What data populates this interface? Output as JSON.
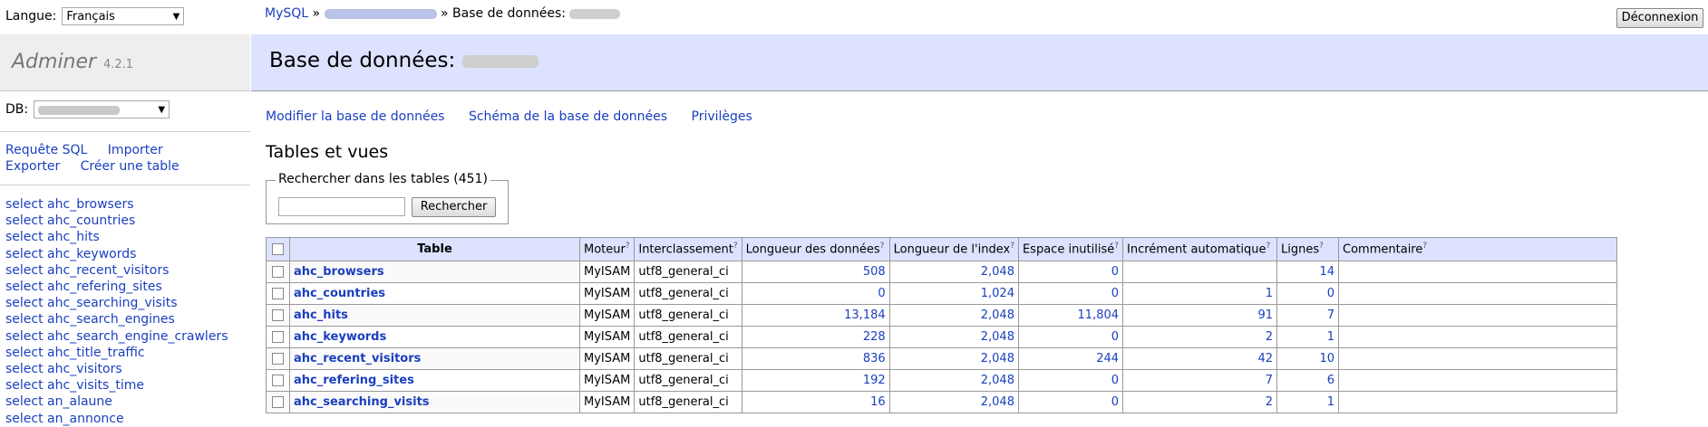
{
  "lang": {
    "label": "Langue:",
    "value": "Français"
  },
  "brand": {
    "name": "Adminer",
    "version": "4.2.1"
  },
  "db": {
    "label": "DB:"
  },
  "quick": {
    "sql": "Requête SQL",
    "import": "Importer",
    "export": "Exporter",
    "create": "Créer une table"
  },
  "sidebar_tables": [
    "select ahc_browsers",
    "select ahc_countries",
    "select ahc_hits",
    "select ahc_keywords",
    "select ahc_recent_visitors",
    "select ahc_refering_sites",
    "select ahc_searching_visits",
    "select ahc_search_engines",
    "select ahc_search_engine_crawlers",
    "select ahc_title_traffic",
    "select ahc_visitors",
    "select ahc_visits_time",
    "select an_alaune",
    "select an_annonce"
  ],
  "breadcrumb": {
    "root": "MySQL",
    "sep": "»",
    "db": "Base de données:"
  },
  "logout": "Déconnexion",
  "title": "Base de données:",
  "links": {
    "alter": "Modifier la base de données",
    "schema": "Schéma de la base de données",
    "privs": "Privilèges"
  },
  "tv_heading": "Tables et vues",
  "search": {
    "legend": "Rechercher dans les tables (451)",
    "button": "Rechercher",
    "value": ""
  },
  "table": {
    "headers": {
      "table": "Table",
      "engine": "Moteur",
      "collation": "Interclassement",
      "data_length": "Longueur des données",
      "index_length": "Longueur de l'index",
      "data_free": "Espace inutilisé",
      "auto_inc": "Incrément automatique",
      "rows": "Lignes",
      "comment": "Commentaire",
      "help": "?"
    },
    "rows": [
      {
        "name": "ahc_browsers",
        "engine": "MyISAM",
        "collation": "utf8_general_ci",
        "data": "508",
        "index": "2,048",
        "free": "0",
        "auto": "",
        "rows": "14"
      },
      {
        "name": "ahc_countries",
        "engine": "MyISAM",
        "collation": "utf8_general_ci",
        "data": "0",
        "index": "1,024",
        "free": "0",
        "auto": "1",
        "rows": "0"
      },
      {
        "name": "ahc_hits",
        "engine": "MyISAM",
        "collation": "utf8_general_ci",
        "data": "13,184",
        "index": "2,048",
        "free": "11,804",
        "auto": "91",
        "rows": "7"
      },
      {
        "name": "ahc_keywords",
        "engine": "MyISAM",
        "collation": "utf8_general_ci",
        "data": "228",
        "index": "2,048",
        "free": "0",
        "auto": "2",
        "rows": "1"
      },
      {
        "name": "ahc_recent_visitors",
        "engine": "MyISAM",
        "collation": "utf8_general_ci",
        "data": "836",
        "index": "2,048",
        "free": "244",
        "auto": "42",
        "rows": "10"
      },
      {
        "name": "ahc_refering_sites",
        "engine": "MyISAM",
        "collation": "utf8_general_ci",
        "data": "192",
        "index": "2,048",
        "free": "0",
        "auto": "7",
        "rows": "6"
      },
      {
        "name": "ahc_searching_visits",
        "engine": "MyISAM",
        "collation": "utf8_general_ci",
        "data": "16",
        "index": "2,048",
        "free": "0",
        "auto": "2",
        "rows": "1"
      }
    ]
  }
}
